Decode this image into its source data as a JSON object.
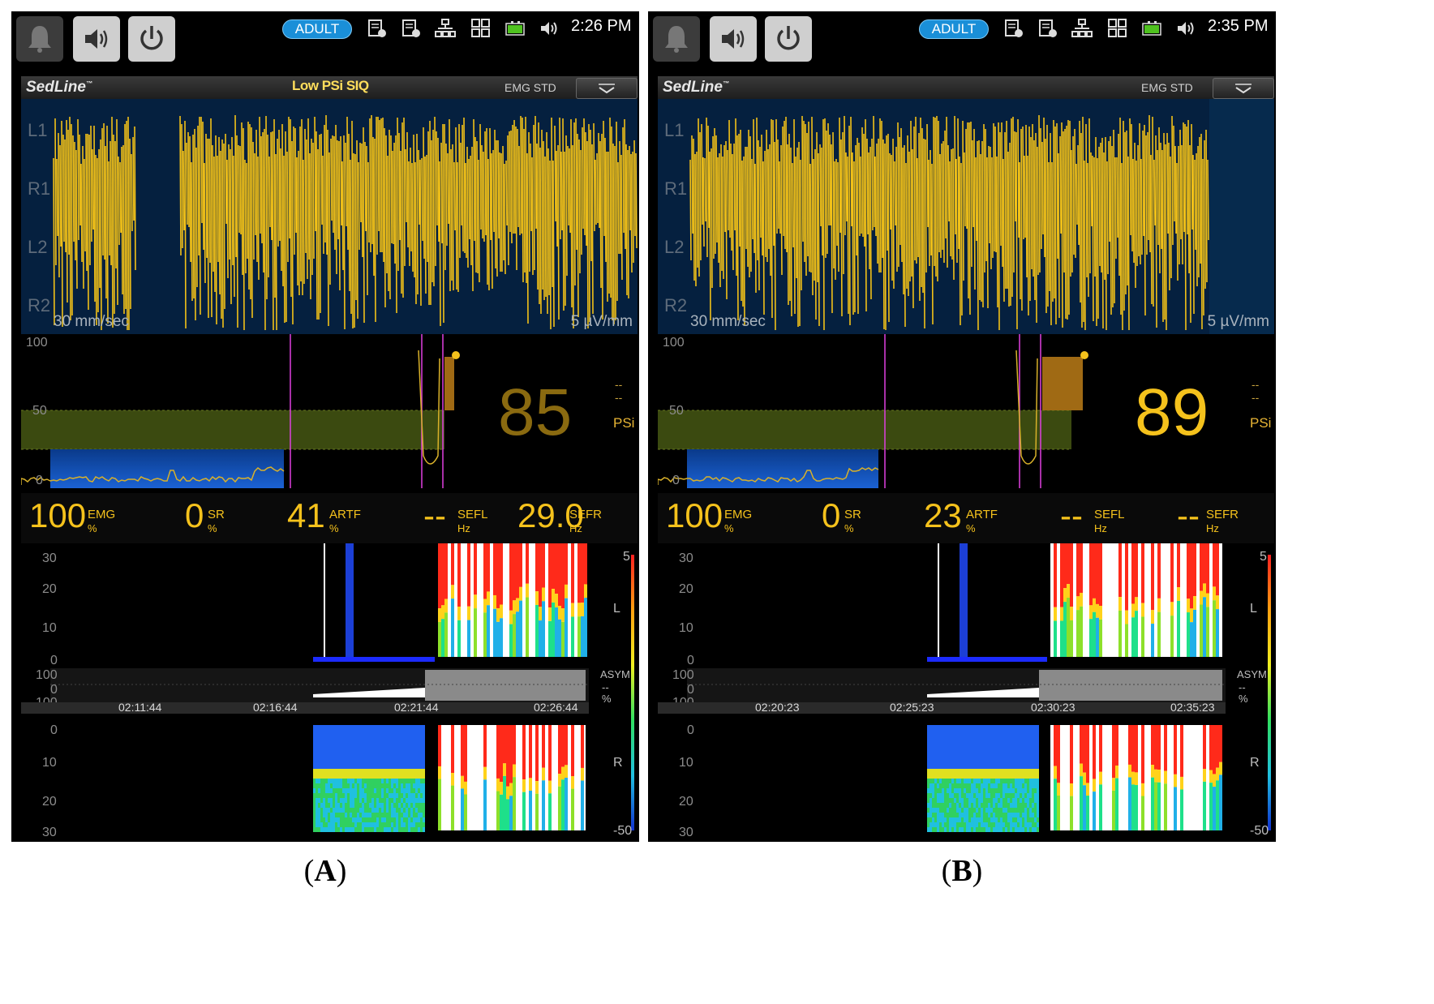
{
  "panels": [
    {
      "caption": "A",
      "top_bar": {
        "mode_badge": "ADULT",
        "clock": "2:26 PM",
        "buttons": [
          "bell-icon",
          "speaker-icon",
          "power-icon"
        ],
        "status_icons": [
          "module-1-icon",
          "module-2-icon",
          "network-icon",
          "layout-icon",
          "battery-icon",
          "volume-icon"
        ]
      },
      "sedline": {
        "title": "SedLine",
        "trademark": "™",
        "alarm_message": "Low PSi SIQ",
        "mode": "EMG STD"
      },
      "eeg": {
        "channels": [
          "L1",
          "R1",
          "L2",
          "R2"
        ],
        "sweep_speed": "30 mm/sec",
        "scale": "5 µV/mm"
      },
      "psi": {
        "axis_top": "100",
        "axis_mid": "50",
        "axis_bottom": "0",
        "value": "85",
        "value_color": "#8a6a10",
        "limit_high": "--",
        "limit_low": "--",
        "label": "PSi"
      },
      "params": [
        {
          "value": "100",
          "name": "EMG",
          "unit": "%"
        },
        {
          "value": "0",
          "name": "SR",
          "unit": "%"
        },
        {
          "value": "41",
          "name": "ARTF",
          "unit": "%"
        },
        {
          "value": "--",
          "name": "SEFL",
          "unit": "Hz"
        },
        {
          "value": "29.0",
          "name": "SEFR",
          "unit": "Hz"
        }
      ],
      "dsa": {
        "left_axis": [
          "30",
          "20",
          "10",
          "0"
        ],
        "asym_axis": [
          "100",
          "0",
          "100"
        ],
        "right_axis": [
          "0",
          "10",
          "20",
          "30"
        ],
        "scale_top": "5",
        "scale_bottom": "-50",
        "label_left": "L",
        "label_right": "R",
        "asym_label": "ASYM",
        "asym_value": "--",
        "asym_unit": "%",
        "times": [
          "02:11:44",
          "02:16:44",
          "02:21:44",
          "02:26:44"
        ]
      }
    },
    {
      "caption": "B",
      "top_bar": {
        "mode_badge": "ADULT",
        "clock": "2:35 PM",
        "buttons": [
          "bell-icon",
          "speaker-icon",
          "power-icon"
        ],
        "status_icons": [
          "module-1-icon",
          "module-2-icon",
          "network-icon",
          "layout-icon",
          "battery-icon",
          "volume-icon"
        ]
      },
      "sedline": {
        "title": "SedLine",
        "trademark": "™",
        "alarm_message": "",
        "mode": "EMG STD"
      },
      "eeg": {
        "channels": [
          "L1",
          "R1",
          "L2",
          "R2"
        ],
        "sweep_speed": "30 mm/sec",
        "scale": "5 µV/mm"
      },
      "psi": {
        "axis_top": "100",
        "axis_mid": "50",
        "axis_bottom": "0",
        "value": "89",
        "value_color": "#f5c21c",
        "limit_high": "--",
        "limit_low": "--",
        "label": "PSi"
      },
      "params": [
        {
          "value": "100",
          "name": "EMG",
          "unit": "%"
        },
        {
          "value": "0",
          "name": "SR",
          "unit": "%"
        },
        {
          "value": "23",
          "name": "ARTF",
          "unit": "%"
        },
        {
          "value": "--",
          "name": "SEFL",
          "unit": "Hz"
        },
        {
          "value": "--",
          "name": "SEFR",
          "unit": "Hz"
        }
      ],
      "dsa": {
        "left_axis": [
          "30",
          "20",
          "10",
          "0"
        ],
        "asym_axis": [
          "100",
          "0",
          "100"
        ],
        "right_axis": [
          "0",
          "10",
          "20",
          "30"
        ],
        "scale_top": "5",
        "scale_bottom": "-50",
        "label_left": "L",
        "label_right": "R",
        "asym_label": "ASYM",
        "asym_value": "--",
        "asym_unit": "%",
        "times": [
          "02:20:23",
          "02:25:23",
          "02:30:23",
          "02:35:23"
        ]
      }
    }
  ],
  "colors": {
    "waveform": "#f2c118",
    "eeg_background": "#05203f",
    "psi_band": "#3b4a10",
    "event_marker": "#e040e0",
    "accent_badge": "#1a8fd8"
  }
}
